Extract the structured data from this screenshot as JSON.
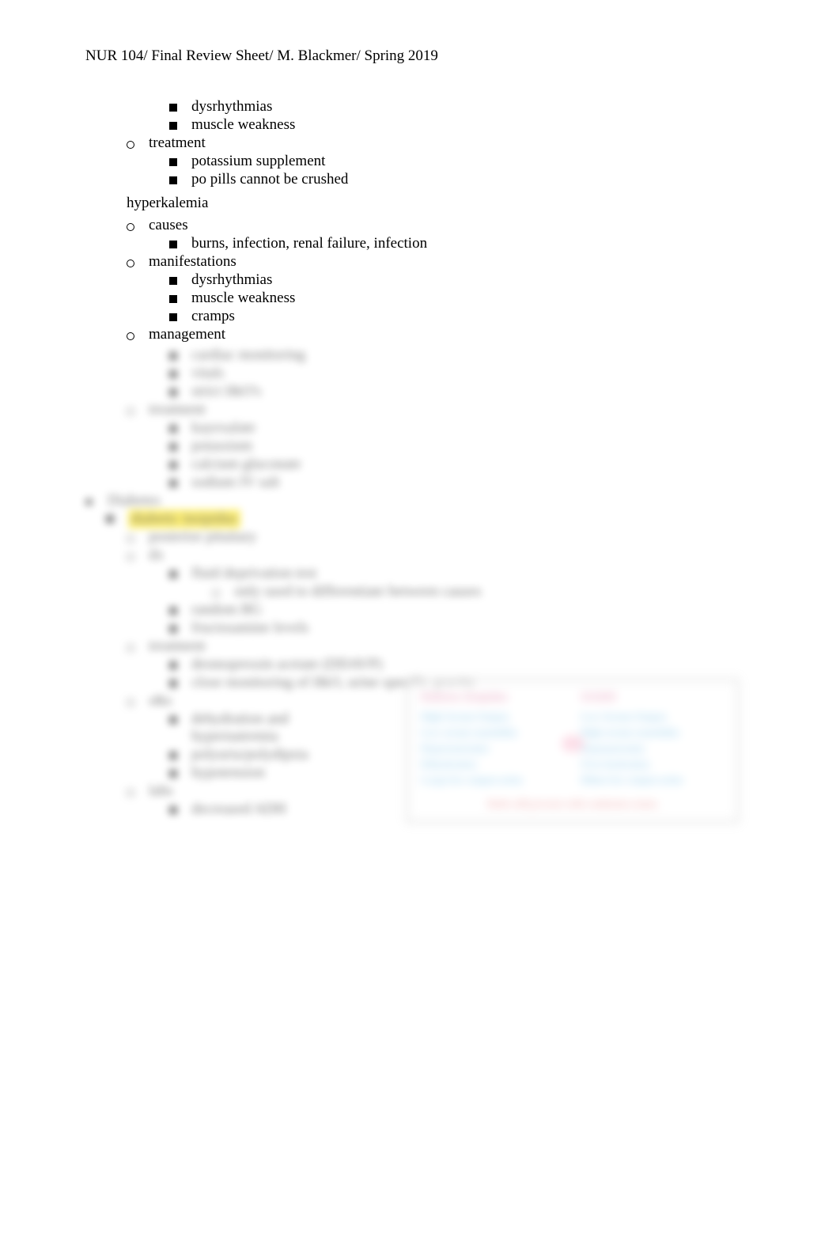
{
  "header": "NUR 104/ Final Review Sheet/ M. Blackmer/ Spring 2019",
  "top": {
    "items": [
      "dysrhythmias",
      "muscle weakness"
    ],
    "treatment_label": "treatment",
    "treatment_items": [
      "potassium supplement",
      "po pills cannot be crushed"
    ]
  },
  "hyperkalemia": {
    "title": "hyperkalemia",
    "causes_label": "causes",
    "causes_items": [
      "burns, infection, renal failure, infection"
    ],
    "manifestations_label": "manifestations",
    "manifestations_items": [
      "dysrhythmias",
      "muscle weakness",
      "cramps"
    ],
    "management_label": "management"
  },
  "blurred": {
    "management_items": [
      "cardiac monitoring",
      "vitals",
      "strict I&O's"
    ],
    "treatment_label": "treatment",
    "treatment_items": [
      "kayexalate",
      "potassium",
      "calcium gluconate",
      "sodium IV salt"
    ],
    "diabetes_label": "Diabetes",
    "mellitus_label": "diabetic insipidus",
    "sections": [
      {
        "label": "posterior pituitary",
        "items": []
      },
      {
        "label": "dx",
        "items": [
          "fluid deprivation test",
          "random BG",
          "fructosamine levels"
        ],
        "sub": [
          "only used to differentiate between causes"
        ]
      },
      {
        "label": "treatment",
        "items": [
          "desmopressin acetate (DDAVP)",
          "close monitoring of I&O, urine specific gravity"
        ]
      },
      {
        "label": "s&s",
        "items": [
          "dehydration and hypernatremia",
          "polyuria/polydipsia",
          "hypotension"
        ]
      },
      {
        "label": "labs",
        "items": [
          "decreased ADH"
        ]
      }
    ]
  },
  "comparison": {
    "left_header": "Diabetes Insipidus",
    "right_header": "SIADH",
    "left_items": [
      "High Serum Output",
      "Low serum osmolality",
      "Hypernatremia",
      "Dehydration",
      "Large low output urine"
    ],
    "right_items": [
      "Low Serum Output",
      "High serum osmolality",
      "Hyponatremia",
      "Over-hydration",
      "Dilute low output urine"
    ],
    "vs_label": "vs",
    "footer": "Both will present with confusion status"
  }
}
